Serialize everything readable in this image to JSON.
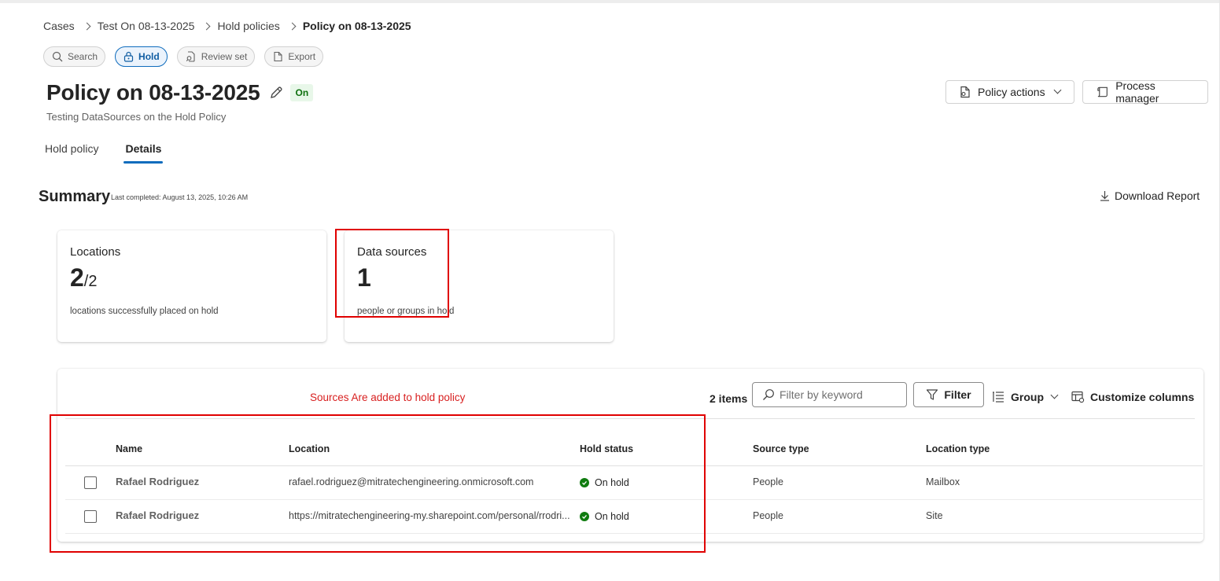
{
  "breadcrumb": {
    "items": [
      "Cases",
      "Test On 08-13-2025",
      "Hold policies",
      "Policy on 08-13-2025"
    ]
  },
  "pills": {
    "search": "Search",
    "hold": "Hold",
    "review_set": "Review set",
    "export": "Export"
  },
  "header": {
    "title": "Policy on 08-13-2025",
    "status_badge": "On",
    "subtitle": "Testing DataSources on the Hold Policy",
    "policy_actions_label": "Policy actions",
    "process_manager_label": "Process manager"
  },
  "tabs": [
    {
      "label": "Hold policy",
      "active": false
    },
    {
      "label": "Details",
      "active": true
    }
  ],
  "summary": {
    "title": "Summary",
    "last_completed": "Last completed: August 13, 2025, 10:26 AM",
    "download_label": "Download Report",
    "cards": [
      {
        "title": "Locations",
        "value": "2",
        "denominator": "/2",
        "description": "locations successfully placed on hold"
      },
      {
        "title": "Data sources",
        "value": "1",
        "description": "people or groups in hold"
      }
    ]
  },
  "annotation": {
    "text": "Sources Are added to hold policy",
    "color": "#e00000"
  },
  "table_toolbar": {
    "items_count": "2 items",
    "filter_placeholder": "Filter by keyword",
    "filter_label": "Filter",
    "group_label": "Group",
    "customize_label": "Customize columns"
  },
  "table": {
    "columns": [
      "Name",
      "Location",
      "Hold status",
      "Source type",
      "Location type"
    ],
    "rows": [
      {
        "name": "Rafael Rodriguez",
        "location": "rafael.rodriguez@mitratechengineering.onmicrosoft.com",
        "hold_status": "On hold",
        "source_type": "People",
        "location_type": "Mailbox"
      },
      {
        "name": "Rafael Rodriguez",
        "location": "https://mitratechengineering-my.sharepoint.com/personal/rrodri...",
        "hold_status": "On hold",
        "source_type": "People",
        "location_type": "Site"
      }
    ]
  },
  "colors": {
    "accent": "#0f6cbd",
    "on_badge_bg": "#e8f7e9",
    "on_hold_green": "#107c10"
  }
}
